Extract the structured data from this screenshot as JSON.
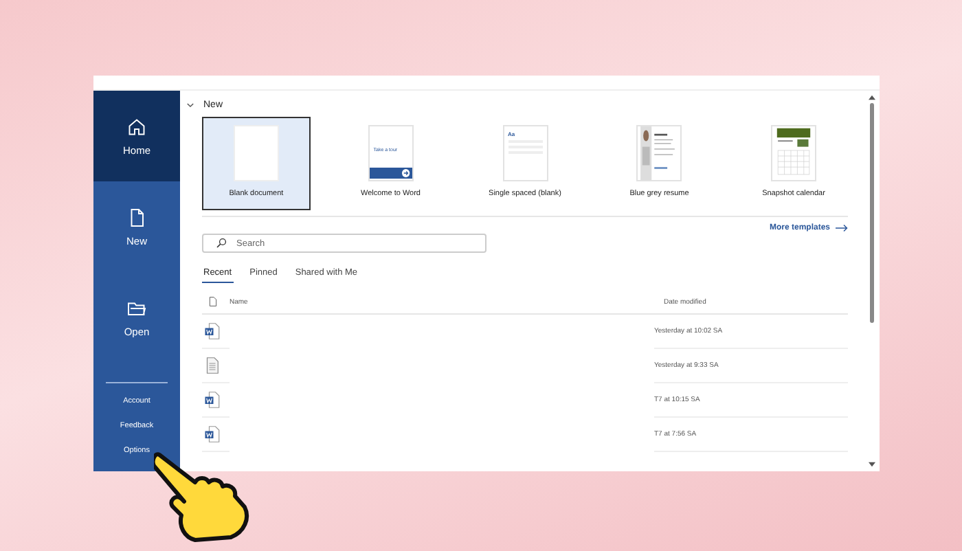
{
  "sidebar": {
    "items": [
      {
        "label": "Home",
        "kind": "home",
        "selected": true
      },
      {
        "label": "New",
        "kind": "new",
        "selected": false
      },
      {
        "label": "Open",
        "kind": "open",
        "selected": false
      }
    ],
    "footer_items": [
      "Account",
      "Feedback",
      "Options"
    ]
  },
  "new_section": {
    "heading": "New",
    "expanded": true,
    "templates": [
      {
        "label": "Blank document",
        "kind": "blank",
        "selected": true
      },
      {
        "label": "Welcome to Word",
        "kind": "tour",
        "thumb_text": "Take a tour",
        "selected": false
      },
      {
        "label": "Single spaced (blank)",
        "kind": "single",
        "thumb_text": "Aa",
        "selected": false
      },
      {
        "label": "Blue grey resume",
        "kind": "resume",
        "selected": false
      },
      {
        "label": "Snapshot calendar",
        "kind": "calendar",
        "selected": false
      }
    ],
    "more_link": "More templates"
  },
  "search": {
    "placeholder": "Search"
  },
  "tabs": [
    {
      "label": "Recent",
      "selected": true
    },
    {
      "label": "Pinned",
      "selected": false
    },
    {
      "label": "Shared with Me",
      "selected": false
    }
  ],
  "file_list": {
    "columns": [
      "Name",
      "Date modified"
    ],
    "rows": [
      {
        "kind": "word",
        "date_modified": "Yesterday at 10:02 SA"
      },
      {
        "kind": "text",
        "date_modified": "Yesterday at 9:33 SA"
      },
      {
        "kind": "word",
        "date_modified": "T7 at 10:15 SA"
      },
      {
        "kind": "word",
        "date_modified": "T7 at 7:56 SA"
      }
    ]
  }
}
